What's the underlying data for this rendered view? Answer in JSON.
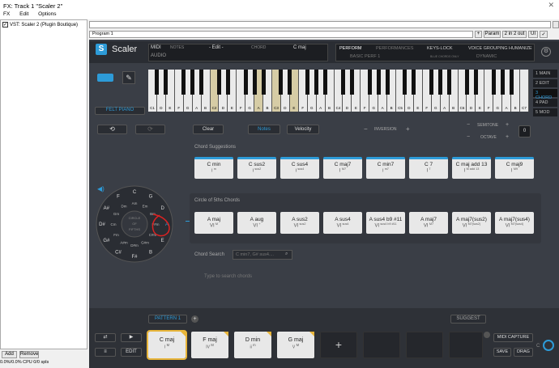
{
  "window": {
    "title": "FX: Track 1 \"Scaler 2\"",
    "close": "✕"
  },
  "menu": [
    "FX",
    "Edit",
    "Options"
  ],
  "fx_list": {
    "item": "VST: Scaler 2 (Plugin Boutique)",
    "checked": "✓",
    "add": "Add",
    "remove": "Remove"
  },
  "status": "0.0%/0.0% CPU 0/0 spls",
  "host_bar": {
    "program": "Program 1",
    "plus": "+",
    "param": "Param",
    "io": "2 in 2 out",
    "ui": "UI",
    "check": "✓"
  },
  "scaler": {
    "logo": "S",
    "name": "Scaler",
    "midi": "MIDI",
    "audio": "AUDIO",
    "notes_label": "NOTES",
    "notes_value": "- Edit -",
    "chord_label": "CHORD",
    "chord_value": "C maj",
    "perf": {
      "perform": "PERFORM",
      "performances": "PERFORMANCES",
      "basic": "BASIC PERF 1",
      "keyslock": "KEYS-LOCK",
      "keyslock_sub": "BLUE CHORDS ONLY",
      "voice": "VOICE GROUPING",
      "dynamic": "DYNAMIC",
      "humanize": "HUMANIZE"
    },
    "side_menu": [
      {
        "n": "1",
        "label": "MAIN"
      },
      {
        "n": "2",
        "label": "EDIT"
      },
      {
        "n": "3",
        "label": "CHORD"
      },
      {
        "n": "4",
        "label": "PAD"
      },
      {
        "n": "5",
        "label": "MOD"
      }
    ],
    "instrument": "FELT PIANO",
    "keys": [
      "C1",
      "D",
      "E",
      "F",
      "G",
      "A",
      "B",
      "C2",
      "D",
      "E",
      "F",
      "G",
      "A",
      "B",
      "C3",
      "D",
      "E",
      "F",
      "G",
      "A",
      "B",
      "C4",
      "D",
      "E",
      "F",
      "G",
      "A",
      "B",
      "C5",
      "D",
      "E",
      "F",
      "G",
      "A",
      "B",
      "C6",
      "D",
      "E",
      "F",
      "G",
      "A",
      "B",
      "C7"
    ],
    "highlight_keys": [
      7,
      12,
      14,
      16
    ],
    "clear": "Clear",
    "notes_btn": "Notes",
    "velocity_btn": "Velocity",
    "inversion": "INVERSION",
    "semitone": "SEMITONE",
    "octave": "OCTAVE",
    "octave_value": "0",
    "suggest_title": "Chord Suggestions",
    "suggestions": [
      {
        "name": "C min",
        "deg": "i",
        "sup": "m"
      },
      {
        "name": "C sus2",
        "deg": "i",
        "sup": "sus2"
      },
      {
        "name": "C sus4",
        "deg": "i",
        "sup": "sus4"
      },
      {
        "name": "C maj7",
        "deg": "I",
        "sup": "M7"
      },
      {
        "name": "C min7",
        "deg": "i",
        "sup": "m7"
      },
      {
        "name": "C 7",
        "deg": "I",
        "sup": "7"
      },
      {
        "name": "C maj add 13",
        "deg": "I",
        "sup": "M add 13"
      },
      {
        "name": "C maj9",
        "deg": "I",
        "sup": "M9"
      }
    ],
    "circle": {
      "center1": "CIRCLE",
      "center2": "OF",
      "center3": "FIFTHS",
      "outer": [
        "C",
        "G",
        "D",
        "A",
        "E",
        "B",
        "F#",
        "C#",
        "G#",
        "D#",
        "A#",
        "F"
      ],
      "inner": [
        "Am",
        "Em",
        "Bm",
        "F#m",
        "C#m",
        "G#m",
        "D#m",
        "A#m",
        "Fm",
        "Cm",
        "Gm",
        "Dm"
      ]
    },
    "fifths_title": "Circle of 5ths Chords",
    "fifths": [
      {
        "name": "A maj",
        "deg": "VI",
        "sup": "M"
      },
      {
        "name": "A aug",
        "deg": "VI",
        "sup": "+"
      },
      {
        "name": "A sus2",
        "deg": "VI",
        "sup": "sus2"
      },
      {
        "name": "A sus4",
        "deg": "VI",
        "sup": "sus4"
      },
      {
        "name": "A sus4 b9 #11",
        "deg": "VI",
        "sup": "sus4 b9 #11"
      },
      {
        "name": "A maj7",
        "deg": "VI",
        "sup": "M7"
      },
      {
        "name": "A maj7(sus2)",
        "deg": "VI",
        "sup": "M7(sus2)"
      },
      {
        "name": "A maj7(sus4)",
        "deg": "VI",
        "sup": "M7(sus4)"
      }
    ],
    "search_title": "Chord Search",
    "search_placeholder": "C min7, G# sus4....",
    "search_hint": "Type to search chords",
    "pattern": "PATTERN 1",
    "suggest": "SUGGEST",
    "edit": "EDIT",
    "patterns": [
      {
        "name": "C maj",
        "deg": "I",
        "sup": "M"
      },
      {
        "name": "F maj",
        "deg": "IV",
        "sup": "M"
      },
      {
        "name": "D min",
        "deg": "ii",
        "sup": "m"
      },
      {
        "name": "G maj",
        "deg": "V",
        "sup": "M"
      }
    ],
    "add": "+",
    "midi_capture": "MIDI CAPTURE",
    "save": "SAVE",
    "drag": "DRAG"
  },
  "colors": {
    "accent": "#2d9bd8",
    "highlight": "#d6cca5",
    "gold": "#e8b53a"
  }
}
